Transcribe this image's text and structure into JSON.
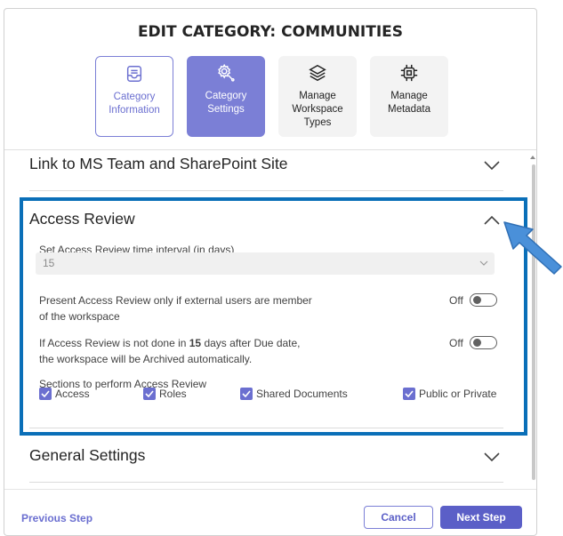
{
  "dialog": {
    "title": "EDIT CATEGORY: COMMUNITIES"
  },
  "steps": [
    {
      "line1": "Category",
      "line2": "Information",
      "line3": "",
      "icon": "document-tray-icon",
      "state": "outlined"
    },
    {
      "line1": "Category",
      "line2": "Settings",
      "line3": "",
      "icon": "gear-wrench-icon",
      "state": "active"
    },
    {
      "line1": "Manage",
      "line2": "Workspace",
      "line3": "Types",
      "icon": "layers-icon",
      "state": "inactive"
    },
    {
      "line1": "Manage",
      "line2": "Metadata",
      "line3": "",
      "icon": "chip-icon",
      "state": "inactive"
    }
  ],
  "sections": {
    "link_ms_team": {
      "title": "Link to MS Team and SharePoint Site",
      "expanded": false
    },
    "access_review": {
      "title": "Access Review",
      "expanded": true,
      "interval_label": "Set Access Review time interval (in days)",
      "interval_value": "15",
      "external_users_line1": "Present Access Review only if external users are member",
      "external_users_line2": "of the workspace",
      "external_users_toggle": "Off",
      "archive_prefix": "If Access Review is not done in ",
      "archive_days": "15",
      "archive_suffix": " days after Due date,",
      "archive_line2": "the workspace will be Archived automatically.",
      "archive_toggle": "Off",
      "sections_label": "Sections to perform Access Review",
      "checkboxes": [
        {
          "label": "Access",
          "checked": true
        },
        {
          "label": "Roles",
          "checked": true
        },
        {
          "label": "Shared Documents",
          "checked": true
        },
        {
          "label": "Public or Private",
          "checked": true
        }
      ]
    },
    "general_settings": {
      "title": "General Settings",
      "expanded": false
    }
  },
  "footer": {
    "previous_label": "Previous Step",
    "cancel_label": "Cancel",
    "next_label": "Next Step"
  },
  "colors": {
    "accent": "#5b5fc7",
    "accent_light": "#7b7fd6",
    "highlight_border": "#0a6fb8",
    "annotation_arrow": "#4a90d9"
  }
}
